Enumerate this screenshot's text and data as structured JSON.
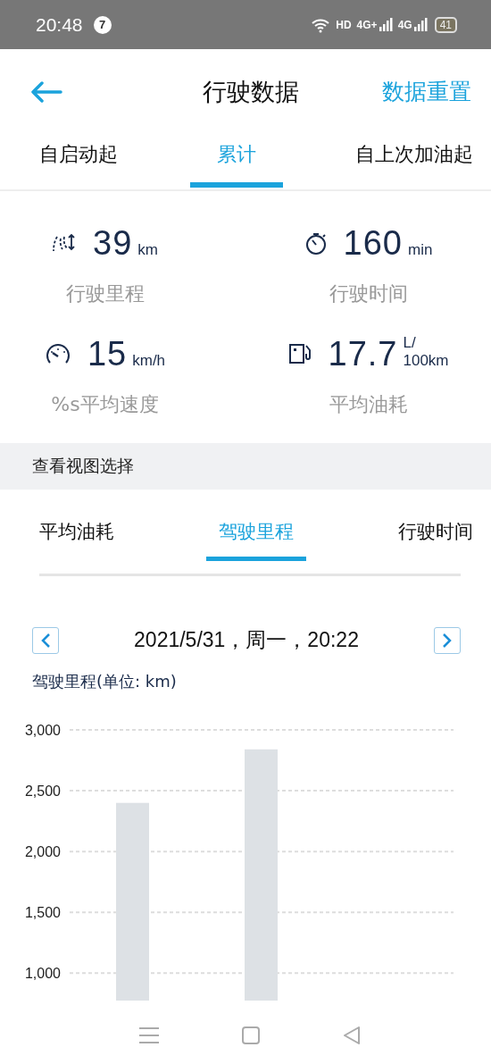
{
  "status_bar": {
    "time": "20:48",
    "notification_count": "7",
    "indicators": [
      "HD",
      "4G+",
      "4G"
    ],
    "battery": "41"
  },
  "header": {
    "title": "行驶数据",
    "action": "数据重置"
  },
  "tabs": [
    {
      "label": "自启动起",
      "selected": false
    },
    {
      "label": "累计",
      "selected": true
    },
    {
      "label": "自上次加油起",
      "selected": false
    }
  ],
  "stats": [
    {
      "kind": "distance",
      "value": "39",
      "unit": [
        "km"
      ],
      "label": "行驶里程"
    },
    {
      "kind": "time",
      "value": "160",
      "unit": [
        "min"
      ],
      "label": "行驶时间"
    },
    {
      "kind": "speed",
      "value": "15",
      "unit": [
        "km/h"
      ],
      "label": "%s平均速度"
    },
    {
      "kind": "fuel",
      "value": "17.7",
      "unit": [
        "L/",
        "100km"
      ],
      "label": "平均油耗"
    }
  ],
  "view_section": {
    "title": "查看视图选择",
    "tabs": [
      {
        "label": "平均油耗",
        "selected": false
      },
      {
        "label": "驾驶里程",
        "selected": true
      },
      {
        "label": "行驶时间",
        "selected": false
      }
    ],
    "date": "2021/5/31，周一，20:22",
    "chart_title": "驾驶里程(单位: km)",
    "chart_data": {
      "type": "bar",
      "grid": true,
      "values": [
        2400,
        2840
      ],
      "ylim": [
        775,
        3000
      ],
      "yticks": [
        {
          "value": 1000,
          "label": "1,000"
        },
        {
          "value": 1500,
          "label": "1,500"
        },
        {
          "value": 2000,
          "label": "2,000"
        },
        {
          "value": 2500,
          "label": "2,500"
        },
        {
          "value": 3000,
          "label": "3,000"
        }
      ]
    }
  }
}
